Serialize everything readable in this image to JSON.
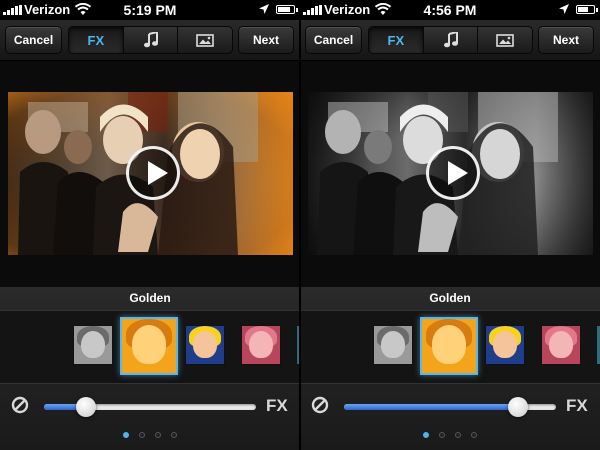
{
  "screens": [
    {
      "status": {
        "carrier": "Verizon",
        "time": "5:19 PM"
      },
      "toolbar": {
        "cancel": "Cancel",
        "fx": "FX",
        "next": "Next"
      },
      "video": {
        "style": "golden"
      },
      "filter_name": "Golden",
      "slider": {
        "value": 0.2
      },
      "fx_label": "FX",
      "page_dots": {
        "count": 4,
        "active": 0
      }
    },
    {
      "status": {
        "carrier": "Verizon",
        "time": "4:56 PM"
      },
      "toolbar": {
        "cancel": "Cancel",
        "fx": "FX",
        "next": "Next"
      },
      "video": {
        "style": "bw"
      },
      "filter_name": "Golden",
      "slider": {
        "value": 0.82
      },
      "fx_label": "FX",
      "page_dots": {
        "count": 4,
        "active": 0
      }
    }
  ],
  "colors": {
    "accent": "#4fb5ea",
    "slider_fill": "#3a78d8",
    "selected_border": "#5cb6e8"
  },
  "icons": {
    "fx_tab": "fx-text",
    "music_tab": "music-note-icon",
    "photo_tab": "photo-icon",
    "none": "no-filter-icon"
  }
}
